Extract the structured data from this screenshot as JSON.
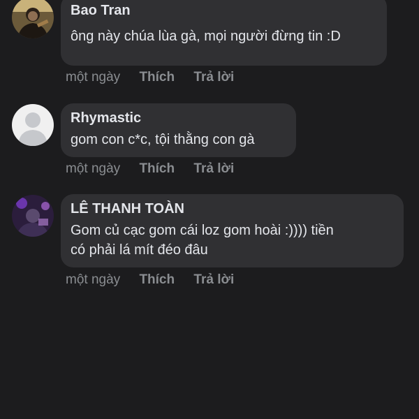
{
  "comments": [
    {
      "author": "Bao Tran",
      "text": "ông này chúa lùa gà, mọi người đừng tin :D",
      "time": "một ngày",
      "like": "Thích",
      "reply": "Trả lời",
      "avatar": "profile-photo-icon"
    },
    {
      "author": "Rhymastic",
      "text": "gom con c*c, tội thằng con gà",
      "time": "một ngày",
      "like": "Thích",
      "reply": "Trả lời",
      "avatar": "default-user-icon"
    },
    {
      "author": "LÊ THANH TOÀN",
      "text": "Gom củ cạc gom cái loz gom hoài :)))) tiền\ncó phải lá mít đéo đâu",
      "time": "một ngày",
      "like": "Thích",
      "reply": "Trả lời",
      "avatar": "profile-photo-icon"
    }
  ],
  "colors": {
    "background": "#1c1c1e",
    "bubble": "#303033",
    "text": "#e4e6eb",
    "meta": "#8a8d91"
  }
}
